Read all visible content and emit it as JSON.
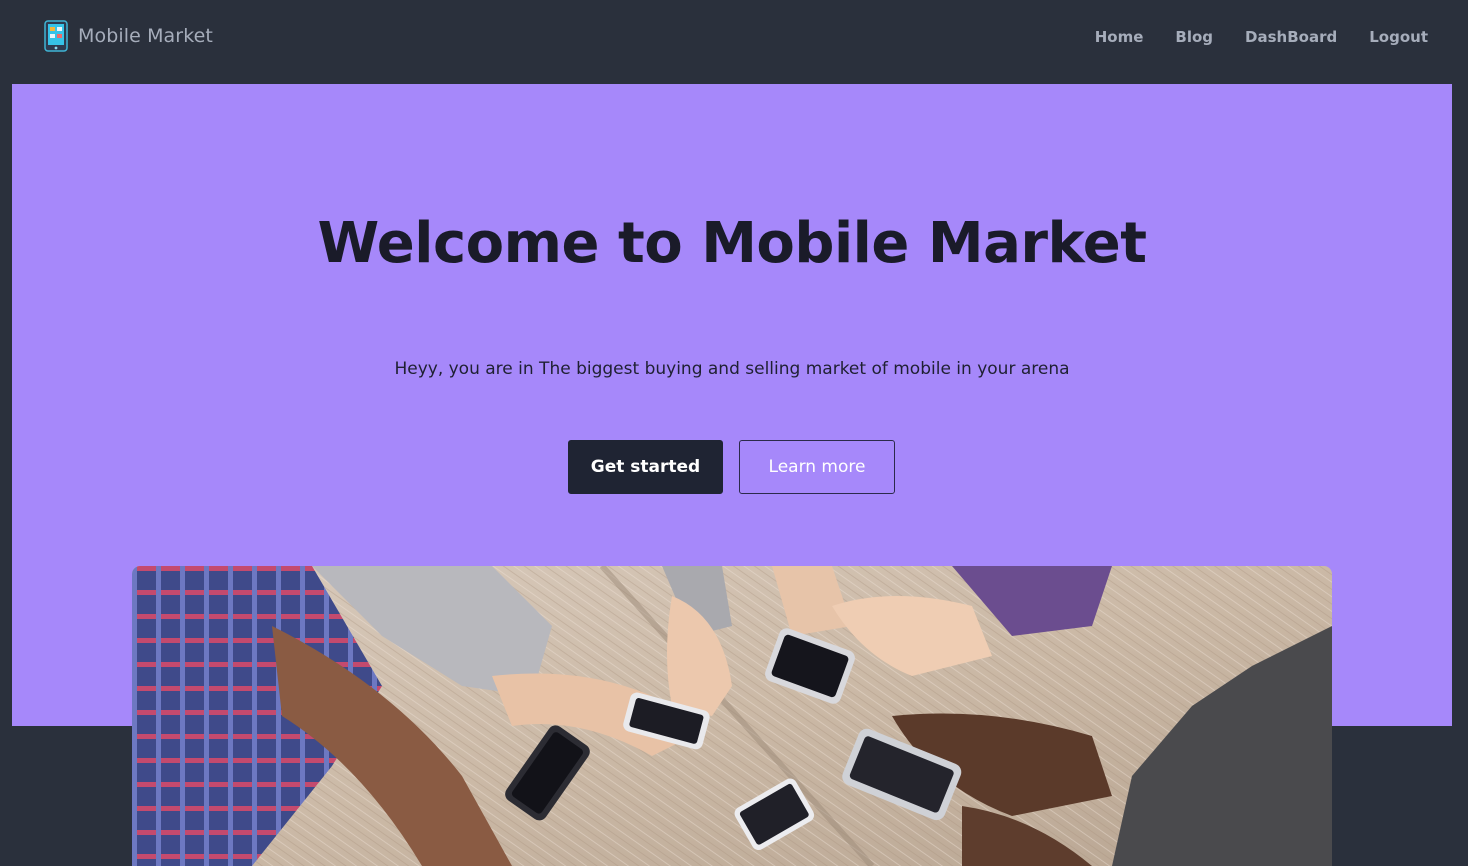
{
  "navbar": {
    "brand_label": "Mobile Market",
    "brand_icon": "mobile-phone-icon",
    "links": [
      {
        "label": "Home"
      },
      {
        "label": "Blog"
      },
      {
        "label": "DashBoard"
      },
      {
        "label": "Logout"
      }
    ]
  },
  "hero": {
    "title": "Welcome to Mobile Market",
    "subtitle": "Heyy, you are in The biggest buying and selling market of mobile in your arena",
    "primary_button": "Get started",
    "secondary_button": "Learn more",
    "image_alt": "people-using-smartphones-photo"
  },
  "colors": {
    "nav_bg": "#2a303c",
    "nav_text": "#a6adbb",
    "hero_bg": "#a688fa",
    "title": "#1a1b29",
    "primary_btn_bg": "#1f2433"
  }
}
